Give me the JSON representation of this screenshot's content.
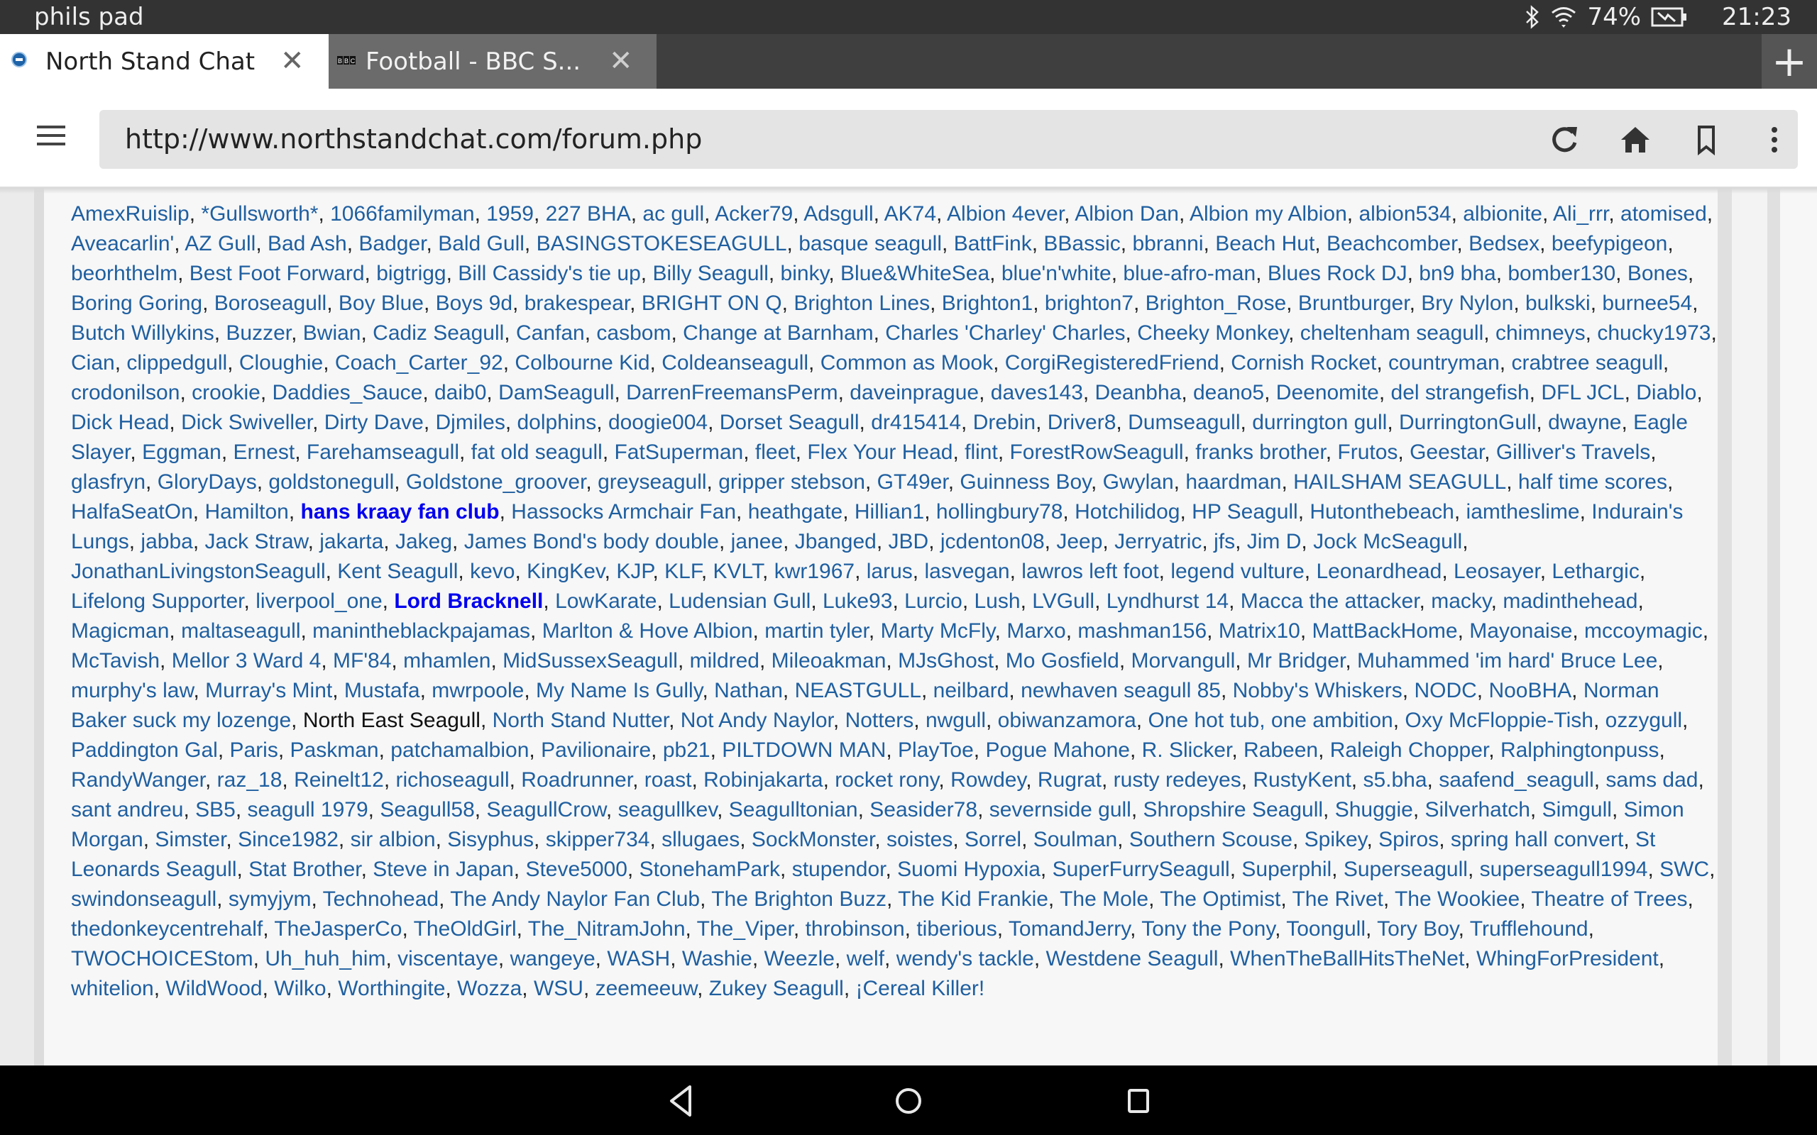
{
  "statusbar": {
    "device_name": "phils pad",
    "battery": "74%",
    "time": "21:23",
    "icons": [
      "bluetooth-icon",
      "wifi-icon",
      "battery-charging-icon"
    ]
  },
  "tabs": [
    {
      "title": "North Stand Chat",
      "favicon": "brighton-crest-icon",
      "active": true,
      "close": "✕"
    },
    {
      "title": "Football - BBC S...",
      "favicon": "bbc-icon",
      "active": false,
      "close": "✕"
    }
  ],
  "new_tab_label": "+",
  "toolbar": {
    "url": "http://www.northstandchat.com/forum.php",
    "icons": [
      "menu-icon",
      "reload-icon",
      "home-icon",
      "bookmark-icon",
      "overflow-menu-icon"
    ]
  },
  "colors": {
    "link": "#1f5fa0",
    "highlight_link": "#0000ee",
    "statusbar": "#333333",
    "tab_inactive": "#6b6b6c"
  },
  "members": [
    {
      "name": "AmexRuislip"
    },
    {
      "name": "*Gullsworth*"
    },
    {
      "name": "1066familyman"
    },
    {
      "name": "1959"
    },
    {
      "name": "227 BHA"
    },
    {
      "name": "ac gull"
    },
    {
      "name": "Acker79"
    },
    {
      "name": "Adsgull"
    },
    {
      "name": "AK74"
    },
    {
      "name": "Albion 4ever"
    },
    {
      "name": "Albion Dan"
    },
    {
      "name": "Albion my Albion"
    },
    {
      "name": "albion534"
    },
    {
      "name": "albionite"
    },
    {
      "name": "Ali_rrr"
    },
    {
      "name": "atomised"
    },
    {
      "name": "Aveacarlin'"
    },
    {
      "name": "AZ Gull"
    },
    {
      "name": "Bad Ash"
    },
    {
      "name": "Badger"
    },
    {
      "name": "Bald Gull"
    },
    {
      "name": "BASINGSTOKESEAGULL"
    },
    {
      "name": "basque seagull"
    },
    {
      "name": "BattFink"
    },
    {
      "name": "BBassic"
    },
    {
      "name": "bbranni"
    },
    {
      "name": "Beach Hut"
    },
    {
      "name": "Beachcomber"
    },
    {
      "name": "Bedsex"
    },
    {
      "name": "beefypigeon"
    },
    {
      "name": "beorhthelm"
    },
    {
      "name": "Best Foot Forward"
    },
    {
      "name": "bigtrigg"
    },
    {
      "name": "Bill Cassidy's tie up"
    },
    {
      "name": "Billy Seagull"
    },
    {
      "name": "binky"
    },
    {
      "name": "Blue&WhiteSea"
    },
    {
      "name": "blue'n'white"
    },
    {
      "name": "blue-afro-man"
    },
    {
      "name": "Blues Rock DJ"
    },
    {
      "name": "bn9 bha"
    },
    {
      "name": "bomber130"
    },
    {
      "name": "Bones"
    },
    {
      "name": "Boring Goring"
    },
    {
      "name": "Boroseagull"
    },
    {
      "name": "Boy Blue"
    },
    {
      "name": "Boys 9d"
    },
    {
      "name": "brakespear"
    },
    {
      "name": "BRIGHT ON Q"
    },
    {
      "name": "Brighton Lines"
    },
    {
      "name": "Brighton1"
    },
    {
      "name": "brighton7"
    },
    {
      "name": "Brighton_Rose"
    },
    {
      "name": "Bruntburger"
    },
    {
      "name": "Bry Nylon"
    },
    {
      "name": "bulkski"
    },
    {
      "name": "burnee54"
    },
    {
      "name": "Butch Willykins"
    },
    {
      "name": "Buzzer"
    },
    {
      "name": "Bwian"
    },
    {
      "name": "Cadiz Seagull"
    },
    {
      "name": "Canfan"
    },
    {
      "name": "casbom"
    },
    {
      "name": "Change at Barnham"
    },
    {
      "name": "Charles 'Charley' Charles"
    },
    {
      "name": "Cheeky Monkey"
    },
    {
      "name": "cheltenham seagull"
    },
    {
      "name": "chimneys"
    },
    {
      "name": "chucky1973"
    },
    {
      "name": "Cian"
    },
    {
      "name": "clippedgull"
    },
    {
      "name": "Cloughie"
    },
    {
      "name": "Coach_Carter_92"
    },
    {
      "name": "Colbourne Kid"
    },
    {
      "name": "Coldeanseagull"
    },
    {
      "name": "Common as Mook"
    },
    {
      "name": "CorgiRegisteredFriend"
    },
    {
      "name": "Cornish Rocket"
    },
    {
      "name": "countryman"
    },
    {
      "name": "crabtree seagull"
    },
    {
      "name": "crodonilson"
    },
    {
      "name": "crookie"
    },
    {
      "name": "Daddies_Sauce"
    },
    {
      "name": "daib0"
    },
    {
      "name": "DamSeagull"
    },
    {
      "name": "DarrenFreemansPerm"
    },
    {
      "name": "daveinprague"
    },
    {
      "name": "daves143"
    },
    {
      "name": "Deanbha"
    },
    {
      "name": "deano5"
    },
    {
      "name": "Deenomite"
    },
    {
      "name": "del strangefish"
    },
    {
      "name": "DFL JCL"
    },
    {
      "name": "Diablo"
    },
    {
      "name": "Dick Head"
    },
    {
      "name": "Dick Swiveller"
    },
    {
      "name": "Dirty Dave"
    },
    {
      "name": "Djmiles"
    },
    {
      "name": "dolphins"
    },
    {
      "name": "doogie004"
    },
    {
      "name": "Dorset Seagull"
    },
    {
      "name": "dr415414"
    },
    {
      "name": "Drebin"
    },
    {
      "name": "Driver8"
    },
    {
      "name": "Dumseagull"
    },
    {
      "name": "durrington gull"
    },
    {
      "name": "DurringtonGull"
    },
    {
      "name": "dwayne"
    },
    {
      "name": "Eagle Slayer"
    },
    {
      "name": "Eggman"
    },
    {
      "name": "Ernest"
    },
    {
      "name": "Farehamseagull"
    },
    {
      "name": "fat old seagull"
    },
    {
      "name": "FatSuperman"
    },
    {
      "name": "fleet"
    },
    {
      "name": "Flex Your Head"
    },
    {
      "name": "flint"
    },
    {
      "name": "ForestRowSeagull"
    },
    {
      "name": "franks brother"
    },
    {
      "name": "Frutos"
    },
    {
      "name": "Geestar"
    },
    {
      "name": "Gilliver's Travels"
    },
    {
      "name": "glasfryn"
    },
    {
      "name": "GloryDays"
    },
    {
      "name": "goldstonegull"
    },
    {
      "name": "Goldstone_groover"
    },
    {
      "name": "greyseagull"
    },
    {
      "name": "gripper stebson"
    },
    {
      "name": "GT49er"
    },
    {
      "name": "Guinness Boy"
    },
    {
      "name": "Gwylan"
    },
    {
      "name": "haardman"
    },
    {
      "name": "HAILSHAM SEAGULL"
    },
    {
      "name": "half time scores"
    },
    {
      "name": "HalfaSeatOn"
    },
    {
      "name": "Hamilton"
    },
    {
      "name": "hans kraay fan club",
      "style": "bold"
    },
    {
      "name": "Hassocks Armchair Fan"
    },
    {
      "name": "heathgate"
    },
    {
      "name": "Hillian1"
    },
    {
      "name": "hollingbury78"
    },
    {
      "name": "Hotchilidog"
    },
    {
      "name": "HP Seagull"
    },
    {
      "name": "Hutonthebeach"
    },
    {
      "name": "iamtheslime"
    },
    {
      "name": "Indurain's Lungs"
    },
    {
      "name": "jabba"
    },
    {
      "name": "Jack Straw"
    },
    {
      "name": "jakarta"
    },
    {
      "name": "Jakeg"
    },
    {
      "name": "James Bond's body double"
    },
    {
      "name": "janee"
    },
    {
      "name": "Jbanged"
    },
    {
      "name": "JBD"
    },
    {
      "name": "jcdenton08"
    },
    {
      "name": "Jeep"
    },
    {
      "name": "Jerryatric"
    },
    {
      "name": "jfs"
    },
    {
      "name": "Jim D"
    },
    {
      "name": "Jock McSeagull"
    },
    {
      "name": "JonathanLivingstonSeagull"
    },
    {
      "name": "Kent Seagull"
    },
    {
      "name": "kevo"
    },
    {
      "name": "KingKev"
    },
    {
      "name": "KJP"
    },
    {
      "name": "KLF"
    },
    {
      "name": "KVLT"
    },
    {
      "name": "kwr1967"
    },
    {
      "name": "larus"
    },
    {
      "name": "lasvegan"
    },
    {
      "name": "lawros left foot"
    },
    {
      "name": "legend vulture"
    },
    {
      "name": "Leonardhead"
    },
    {
      "name": "Leosayer"
    },
    {
      "name": "Lethargic"
    },
    {
      "name": "Lifelong Supporter"
    },
    {
      "name": "liverpool_one"
    },
    {
      "name": "Lord Bracknell",
      "style": "bold"
    },
    {
      "name": "LowKarate"
    },
    {
      "name": "Ludensian Gull"
    },
    {
      "name": "Luke93"
    },
    {
      "name": "Lurcio"
    },
    {
      "name": "Lush"
    },
    {
      "name": "LVGull"
    },
    {
      "name": "Lyndhurst 14"
    },
    {
      "name": "Macca the attacker"
    },
    {
      "name": "macky"
    },
    {
      "name": "madinthehead"
    },
    {
      "name": "Magicman"
    },
    {
      "name": "maltaseagull"
    },
    {
      "name": "manintheblackpajamas"
    },
    {
      "name": "Marlton & Hove Albion"
    },
    {
      "name": "martin tyler"
    },
    {
      "name": "Marty McFly"
    },
    {
      "name": "Marxo"
    },
    {
      "name": "mashman156"
    },
    {
      "name": "Matrix10"
    },
    {
      "name": "MattBackHome"
    },
    {
      "name": "Mayonaise"
    },
    {
      "name": "mccoymagic"
    },
    {
      "name": "McTavish"
    },
    {
      "name": "Mellor 3 Ward 4"
    },
    {
      "name": "MF'84"
    },
    {
      "name": "mhamlen"
    },
    {
      "name": "MidSussexSeagull"
    },
    {
      "name": "mildred"
    },
    {
      "name": "Mileoakman"
    },
    {
      "name": "MJsGhost"
    },
    {
      "name": "Mo Gosfield"
    },
    {
      "name": "Morvangull"
    },
    {
      "name": "Mr Bridger"
    },
    {
      "name": "Muhammed 'im hard' Bruce Lee"
    },
    {
      "name": "murphy's law"
    },
    {
      "name": "Murray's Mint"
    },
    {
      "name": "Mustafa"
    },
    {
      "name": "mwrpoole"
    },
    {
      "name": "My Name Is Gully"
    },
    {
      "name": "Nathan"
    },
    {
      "name": "NEASTGULL"
    },
    {
      "name": "neilbard"
    },
    {
      "name": "newhaven seagull 85"
    },
    {
      "name": "Nobby's Whiskers"
    },
    {
      "name": "NODC"
    },
    {
      "name": "NooBHA"
    },
    {
      "name": "Norman Baker suck my lozenge"
    },
    {
      "name": "North East Seagull",
      "style": "plain"
    },
    {
      "name": "North Stand Nutter"
    },
    {
      "name": "Not Andy Naylor"
    },
    {
      "name": "Notters"
    },
    {
      "name": "nwgull"
    },
    {
      "name": "obiwanzamora"
    },
    {
      "name": "One hot tub, one ambition"
    },
    {
      "name": "Oxy McFloppie-Tish"
    },
    {
      "name": "ozzygull"
    },
    {
      "name": "Paddington Gal"
    },
    {
      "name": "Paris"
    },
    {
      "name": "Paskman"
    },
    {
      "name": "patchamalbion"
    },
    {
      "name": "Pavilionaire"
    },
    {
      "name": "pb21"
    },
    {
      "name": "PILTDOWN MAN"
    },
    {
      "name": "PlayToe"
    },
    {
      "name": "Pogue Mahone"
    },
    {
      "name": "R. Slicker"
    },
    {
      "name": "Rabeen"
    },
    {
      "name": "Raleigh Chopper"
    },
    {
      "name": "Ralphingtonpuss"
    },
    {
      "name": "RandyWanger"
    },
    {
      "name": "raz_18"
    },
    {
      "name": "Reinelt12"
    },
    {
      "name": "richoseagull"
    },
    {
      "name": "Roadrunner"
    },
    {
      "name": "roast"
    },
    {
      "name": "Robinjakarta"
    },
    {
      "name": "rocket rony"
    },
    {
      "name": "Rowdey"
    },
    {
      "name": "Rugrat"
    },
    {
      "name": "rusty redeyes"
    },
    {
      "name": "RustyKent"
    },
    {
      "name": "s5.bha"
    },
    {
      "name": "saafend_seagull"
    },
    {
      "name": "sams dad"
    },
    {
      "name": "sant andreu"
    },
    {
      "name": "SB5"
    },
    {
      "name": "seagull 1979"
    },
    {
      "name": "Seagull58"
    },
    {
      "name": "SeagullCrow"
    },
    {
      "name": "seagullkev"
    },
    {
      "name": "Seagulltonian"
    },
    {
      "name": "Seasider78"
    },
    {
      "name": "severnside gull"
    },
    {
      "name": "Shropshire Seagull"
    },
    {
      "name": "Shuggie"
    },
    {
      "name": "Silverhatch"
    },
    {
      "name": "Simgull"
    },
    {
      "name": "Simon Morgan"
    },
    {
      "name": "Simster"
    },
    {
      "name": "Since1982"
    },
    {
      "name": "sir albion"
    },
    {
      "name": "Sisyphus"
    },
    {
      "name": "skipper734"
    },
    {
      "name": "sllugaes"
    },
    {
      "name": "SockMonster"
    },
    {
      "name": "soistes"
    },
    {
      "name": "Sorrel"
    },
    {
      "name": "Soulman"
    },
    {
      "name": "Southern Scouse"
    },
    {
      "name": "Spikey"
    },
    {
      "name": "Spiros"
    },
    {
      "name": "spring hall convert"
    },
    {
      "name": "St Leonards Seagull"
    },
    {
      "name": "Stat Brother"
    },
    {
      "name": "Steve in Japan"
    },
    {
      "name": "Steve5000"
    },
    {
      "name": "StonehamPark"
    },
    {
      "name": "stupendor"
    },
    {
      "name": "Suomi Hypoxia"
    },
    {
      "name": "SuperFurrySeagull"
    },
    {
      "name": "Superphil"
    },
    {
      "name": "Superseagull"
    },
    {
      "name": "superseagull1994"
    },
    {
      "name": "SWC"
    },
    {
      "name": "swindonseagull"
    },
    {
      "name": "symyjym"
    },
    {
      "name": "Technohead"
    },
    {
      "name": "The Andy Naylor Fan Club"
    },
    {
      "name": "The Brighton Buzz"
    },
    {
      "name": "The Kid Frankie"
    },
    {
      "name": "The Mole"
    },
    {
      "name": "The Optimist"
    },
    {
      "name": "The Rivet"
    },
    {
      "name": "The Wookiee"
    },
    {
      "name": "Theatre of Trees"
    },
    {
      "name": "thedonkeycentrehalf"
    },
    {
      "name": "TheJasperCo"
    },
    {
      "name": "TheOldGirl"
    },
    {
      "name": "The_NitramJohn"
    },
    {
      "name": "The_Viper"
    },
    {
      "name": "throbinson"
    },
    {
      "name": "tiberious"
    },
    {
      "name": "TomandJerry"
    },
    {
      "name": "Tony the Pony"
    },
    {
      "name": "Toongull"
    },
    {
      "name": "Tory Boy"
    },
    {
      "name": "Trufflehound"
    },
    {
      "name": "TWOCHOICEStom"
    },
    {
      "name": "Uh_huh_him"
    },
    {
      "name": "viscentaye"
    },
    {
      "name": "wangeye"
    },
    {
      "name": "WASH"
    },
    {
      "name": "Washie"
    },
    {
      "name": "Weezle"
    },
    {
      "name": "welf"
    },
    {
      "name": "wendy's tackle"
    },
    {
      "name": "Westdene Seagull"
    },
    {
      "name": "WhenTheBallHitsTheNet"
    },
    {
      "name": "WhingForPresident"
    },
    {
      "name": "whitelion"
    },
    {
      "name": "WildWood"
    },
    {
      "name": "Wilko"
    },
    {
      "name": "Worthingite"
    },
    {
      "name": "Wozza"
    },
    {
      "name": "WSU"
    },
    {
      "name": "zeemeeuw"
    },
    {
      "name": "Zukey Seagull"
    },
    {
      "name": "¡Cereal Killer!"
    }
  ],
  "separator": ", ",
  "navbar": {
    "buttons": [
      "back-icon",
      "home-circle-icon",
      "recents-icon"
    ]
  }
}
